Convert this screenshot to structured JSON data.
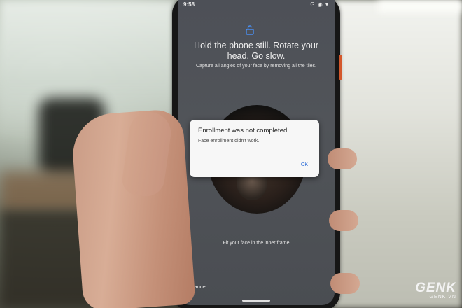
{
  "statusbar": {
    "time": "9:58",
    "icons": "G ◉ ▾"
  },
  "enrollment": {
    "headline": "Hold the phone still. Rotate your head. Go slow.",
    "subline": "Capture all angles of your face by removing all the tiles.",
    "fit_text": "Fit your face in the inner frame",
    "cancel_label": "Cancel",
    "icon": "lock-open-icon"
  },
  "dialog": {
    "title": "Enrollment was not completed",
    "body": "Face enrollment didn't work.",
    "ok_label": "OK"
  },
  "watermark": {
    "logo": "GENK",
    "url": "GENK.VN"
  },
  "colors": {
    "accent": "#2f6fd9",
    "dialog_bg": "#f7f7f7",
    "screen_bg": "#4f5257"
  }
}
